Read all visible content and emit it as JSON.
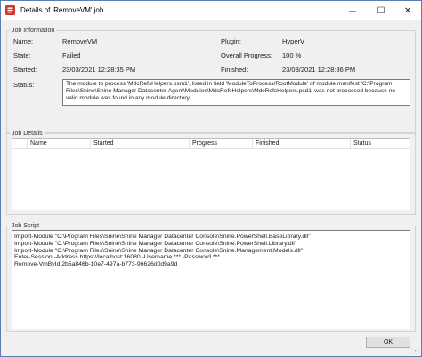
{
  "window": {
    "title": "Details of 'RemoveVM' job",
    "minimize_glyph": "—",
    "maximize_glyph": "☐",
    "close_glyph": "✕"
  },
  "job_info": {
    "group_label": "Job Information",
    "name_label": "Name:",
    "name_value": "RemoveVM",
    "plugin_label": "Plugin:",
    "plugin_value": "HyperV",
    "state_label": "State:",
    "state_value": "Failed",
    "progress_label": "Overall Progress:",
    "progress_value": "100 %",
    "started_label": "Started:",
    "started_value": "23/03/2021 12:28:35 PM",
    "finished_label": "Finished:",
    "finished_value": "23/03/2021 12:28:36 PM",
    "status_label": "Status:",
    "status_lines": [
      "The module to process 'MdcRefsHelpers.psm1', listed in field 'ModuleToProcess/RootModule' of module manifest 'C:\\Program",
      "Files\\Snine\\Snine Manager Datacenter Agent\\Modules\\MdcRefsHelpers\\MdcRefsHelpers.psd1' was not processed because no",
      "valid module was found in any module directory."
    ]
  },
  "job_details": {
    "group_label": "Job Details",
    "columns": [
      "Name",
      "Started",
      "Progress",
      "Finished",
      "Status"
    ]
  },
  "job_script": {
    "group_label": "Job Script",
    "lines": [
      "Import-Module \"C:\\Program Files\\Snine\\Snine Manager Datacenter Console\\Snine.PowerShell.BaseLibrary.dll\"",
      "Import-Module \"C:\\Program Files\\Snine\\Snine Manager Datacenter Console\\Snine.PowerShell.Library.dll\"",
      "Import-Module \"C:\\Program Files\\Snine\\Snine Manager Datacenter Console\\Snine.Management.Models.dll\"",
      "Enter-Session -Address https://localhost:16080 -Username *** -Password ***",
      "Remove-VmById 2b5a846b-10e7-497a-b773-96626d0d9a9d"
    ]
  },
  "footer": {
    "ok_label": "OK"
  },
  "colors": {
    "window_border": "#5a7fae",
    "dialog_bg": "#f0f0f0",
    "icon_red": "#d9342b"
  }
}
